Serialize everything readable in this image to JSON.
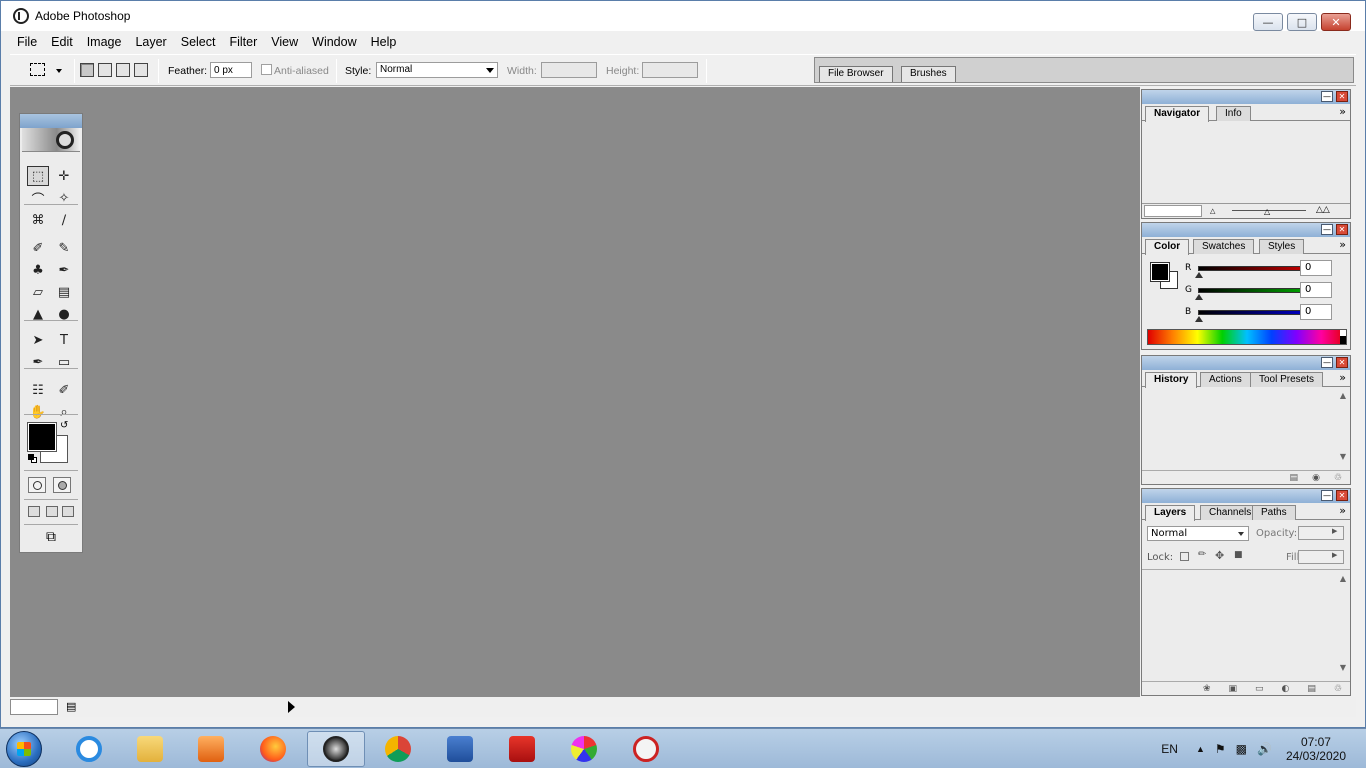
{
  "window": {
    "title": "Adobe Photoshop",
    "minimize": "—",
    "maximize": "□",
    "close": "✕"
  },
  "menu": [
    "File",
    "Edit",
    "Image",
    "Layer",
    "Select",
    "Filter",
    "View",
    "Window",
    "Help"
  ],
  "options": {
    "feather_label": "Feather:",
    "feather_value": "0 px",
    "antialiased_label": "Anti-aliased",
    "style_label": "Style:",
    "style_value": "Normal",
    "width_label": "Width:",
    "width_value": "",
    "height_label": "Height:",
    "height_value": "",
    "well_tabs": [
      "File Browser",
      "Brushes"
    ]
  },
  "toolbox": {
    "tools": [
      {
        "name": "rectangular-marquee-tool",
        "glyph": "⬚",
        "selected": true
      },
      {
        "name": "move-tool",
        "glyph": "✛"
      },
      {
        "name": "lasso-tool",
        "glyph": "⌒"
      },
      {
        "name": "magic-wand-tool",
        "glyph": "✧"
      },
      {
        "name": "crop-tool",
        "glyph": "⌘"
      },
      {
        "name": "slice-tool",
        "glyph": "∕"
      },
      {
        "name": "healing-brush-tool",
        "glyph": "✐"
      },
      {
        "name": "brush-tool",
        "glyph": "✎"
      },
      {
        "name": "clone-stamp-tool",
        "glyph": "♣"
      },
      {
        "name": "history-brush-tool",
        "glyph": "✒"
      },
      {
        "name": "eraser-tool",
        "glyph": "▱"
      },
      {
        "name": "gradient-tool",
        "glyph": "▤"
      },
      {
        "name": "blur-tool",
        "glyph": "▲"
      },
      {
        "name": "dodge-tool",
        "glyph": "●"
      },
      {
        "name": "path-selection-tool",
        "glyph": "➤"
      },
      {
        "name": "type-tool",
        "glyph": "T"
      },
      {
        "name": "pen-tool",
        "glyph": "✒"
      },
      {
        "name": "rectangle-tool",
        "glyph": "▭"
      },
      {
        "name": "notes-tool",
        "glyph": "☷"
      },
      {
        "name": "eyedropper-tool",
        "glyph": "✐"
      },
      {
        "name": "hand-tool",
        "glyph": "✋"
      },
      {
        "name": "zoom-tool",
        "glyph": "⌕"
      }
    ]
  },
  "navigator": {
    "tabs": [
      "Navigator",
      "Info"
    ]
  },
  "color": {
    "tabs": [
      "Color",
      "Swatches",
      "Styles"
    ],
    "channels": [
      {
        "label": "R",
        "value": "0",
        "color": "#cc0000"
      },
      {
        "label": "G",
        "value": "0",
        "color": "#00aa00"
      },
      {
        "label": "B",
        "value": "0",
        "color": "#0000cc"
      }
    ]
  },
  "history": {
    "tabs": [
      "History",
      "Actions",
      "Tool Presets"
    ]
  },
  "layers": {
    "tabs": [
      "Layers",
      "Channels",
      "Paths"
    ],
    "blend_mode": "Normal",
    "opacity_label": "Opacity:",
    "lock_label": "Lock:",
    "fill_label": "Fill:"
  },
  "taskbar": {
    "apps": [
      "internet-explorer",
      "file-explorer",
      "media-player",
      "firefox",
      "photoshop",
      "chrome",
      "word",
      "acrobat",
      "paint",
      "snipping-tool"
    ],
    "language": "EN",
    "time": "07:07",
    "date": "24/03/2020"
  }
}
